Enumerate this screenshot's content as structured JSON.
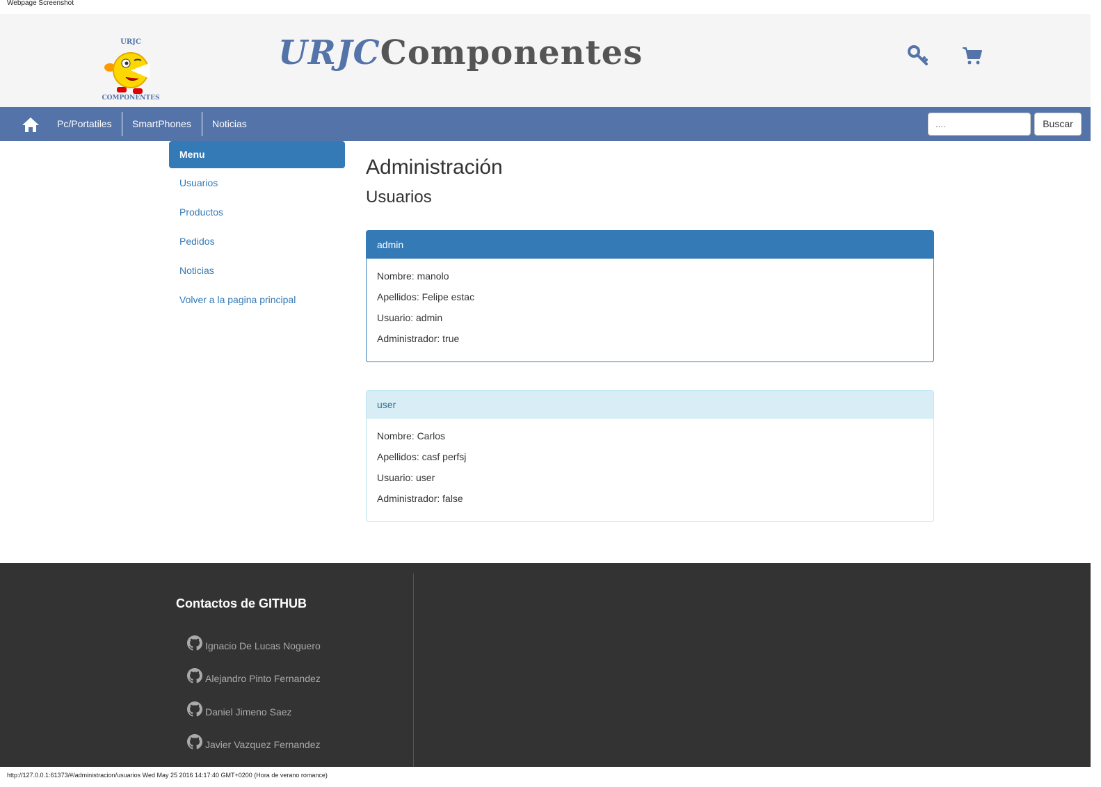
{
  "caption_top": "Webpage Screenshot",
  "header": {
    "logo_top_text": "URJC",
    "logo_bottom_text": "COMPONENTES",
    "brand_part1": "URJC",
    "brand_part2": "Componentes"
  },
  "navbar": {
    "items": [
      {
        "label": "Pc/Portatiles"
      },
      {
        "label": "SmartPhones"
      },
      {
        "label": "Noticias"
      }
    ],
    "search_placeholder": "....",
    "search_button": "Buscar"
  },
  "sidebar": {
    "active": "Menu",
    "items": [
      {
        "label": "Usuarios"
      },
      {
        "label": "Productos"
      },
      {
        "label": "Pedidos"
      },
      {
        "label": "Noticias"
      },
      {
        "label": "Volver a la pagina principal"
      }
    ]
  },
  "main": {
    "title": "Administración",
    "subtitle": "Usuarios",
    "users": [
      {
        "heading": "admin",
        "nombre": "Nombre: manolo",
        "apellidos": "Apellidos: Felipe estac",
        "usuario": "Usuario: admin",
        "administrador": "Administrador: true"
      },
      {
        "heading": "user",
        "nombre": "Nombre: Carlos",
        "apellidos": "Apellidos: casf perfsj",
        "usuario": "Usuario: user",
        "administrador": "Administrador: false"
      }
    ]
  },
  "footer": {
    "title": "Contactos de GITHUB",
    "contacts": [
      {
        "name": "Ignacio De Lucas Noguero"
      },
      {
        "name": "Alejandro Pinto Fernandez"
      },
      {
        "name": "Daniel Jimeno Saez"
      },
      {
        "name": "Javier Vazquez Fernandez"
      }
    ]
  },
  "caption_bottom": "http://127.0.0.1:61373/#/administracion/usuarios Wed May 25 2016 14:17:40 GMT+0200 (Hora de verano romance)",
  "colors": {
    "brand_blue": "#5473a8",
    "primary": "#337ab7",
    "info_bg": "#d9edf7",
    "footer_bg": "#333333"
  }
}
